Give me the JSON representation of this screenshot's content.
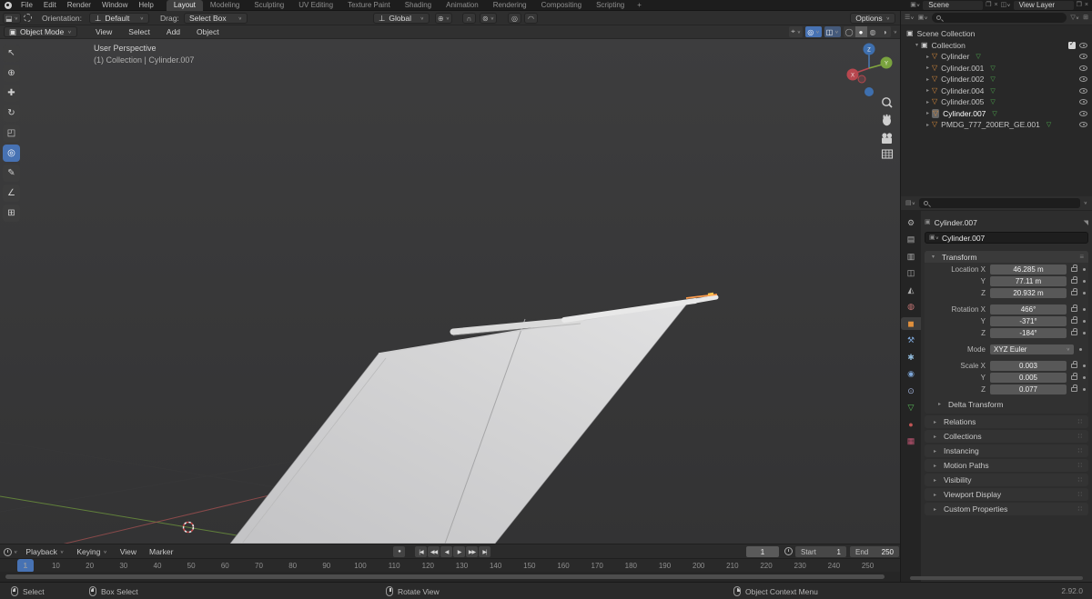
{
  "accent": "#4772b3",
  "topbar": {
    "menus": [
      "File",
      "Edit",
      "Render",
      "Window",
      "Help"
    ],
    "workspaces": [
      {
        "label": "Layout",
        "active": true
      },
      {
        "label": "Modeling"
      },
      {
        "label": "Sculpting"
      },
      {
        "label": "UV Editing"
      },
      {
        "label": "Texture Paint"
      },
      {
        "label": "Shading"
      },
      {
        "label": "Animation"
      },
      {
        "label": "Rendering"
      },
      {
        "label": "Compositing"
      },
      {
        "label": "Scripting"
      }
    ],
    "new_workspace_label": "+",
    "scene": {
      "label": "Scene"
    },
    "view_layer": {
      "label": "View Layer"
    }
  },
  "tool_settings": {
    "orientation_label": "Orientation:",
    "orientation_value": "Default",
    "drag_label": "Drag:",
    "drag_value": "Select Box",
    "transform_orientation": "Global",
    "options_label": "Options"
  },
  "viewport_header": {
    "mode": "Object Mode",
    "menus": [
      "View",
      "Select",
      "Add",
      "Object"
    ]
  },
  "viewport": {
    "overlay_title": "User Perspective",
    "overlay_breadcrumb": "(1) Collection | Cylinder.007",
    "tools": [
      {
        "name": "select-box",
        "glyph": "↖"
      },
      {
        "name": "cursor",
        "glyph": "⊕"
      },
      {
        "name": "move",
        "glyph": "✚"
      },
      {
        "name": "rotate",
        "glyph": "↻"
      },
      {
        "name": "scale",
        "glyph": "◰"
      },
      {
        "name": "transform",
        "glyph": "◎",
        "active": true
      },
      {
        "name": "annotate",
        "glyph": "✎"
      },
      {
        "name": "measure",
        "glyph": "∠"
      },
      {
        "name": "add-cube",
        "glyph": "⊞"
      }
    ]
  },
  "outliner": {
    "scene_collection": "Scene Collection",
    "collection": "Collection",
    "items": [
      {
        "name": "Cylinder"
      },
      {
        "name": "Cylinder.001"
      },
      {
        "name": "Cylinder.002"
      },
      {
        "name": "Cylinder.004"
      },
      {
        "name": "Cylinder.005"
      },
      {
        "name": "Cylinder.007",
        "selected": true
      },
      {
        "name": "PMDG_777_200ER_GE.001"
      }
    ]
  },
  "properties": {
    "tabs": [
      {
        "name": "tool",
        "glyph": "⚙",
        "color": "#b0b0b0"
      },
      {
        "name": "render",
        "glyph": "▤",
        "color": "#b0b0b0"
      },
      {
        "name": "output",
        "glyph": "▥",
        "color": "#b0b0b0"
      },
      {
        "name": "view-layer",
        "glyph": "◫",
        "color": "#b0b0b0"
      },
      {
        "name": "scene",
        "glyph": "◭",
        "color": "#b0b0b0"
      },
      {
        "name": "world",
        "glyph": "◍",
        "color": "#c97777"
      },
      {
        "name": "object",
        "glyph": "◼",
        "color": "#e0903c",
        "active": true
      },
      {
        "name": "modifiers",
        "glyph": "⚒",
        "color": "#7da6d8"
      },
      {
        "name": "particles",
        "glyph": "✱",
        "color": "#8fb8d8"
      },
      {
        "name": "physics",
        "glyph": "◉",
        "color": "#7da6d8"
      },
      {
        "name": "constraints",
        "glyph": "⊙",
        "color": "#9fb0d8"
      },
      {
        "name": "object-data",
        "glyph": "▽",
        "color": "#58b858"
      },
      {
        "name": "material",
        "glyph": "●",
        "color": "#c05555"
      },
      {
        "name": "texture",
        "glyph": "▦",
        "color": "#c05573"
      }
    ],
    "breadcrumb": "Cylinder.007",
    "name_field": "Cylinder.007",
    "transform": {
      "title": "Transform",
      "rows": [
        {
          "label": "Location X",
          "value": "46.285 m"
        },
        {
          "label": "Y",
          "value": "77.11 m"
        },
        {
          "label": "Z",
          "value": "20.932 m"
        },
        {
          "label": "Rotation X",
          "value": "466°",
          "gap": true
        },
        {
          "label": "Y",
          "value": "-371°"
        },
        {
          "label": "Z",
          "value": "-184°"
        },
        {
          "label": "Mode",
          "value": "XYZ Euler",
          "type": "mode",
          "gap": true
        },
        {
          "label": "Scale X",
          "value": "0.003",
          "gap": true
        },
        {
          "label": "Y",
          "value": "0.005"
        },
        {
          "label": "Z",
          "value": "0.077"
        }
      ],
      "delta_label": "Delta Transform"
    },
    "panels": [
      "Relations",
      "Collections",
      "Instancing",
      "Motion Paths",
      "Visibility",
      "Viewport Display",
      "Custom Properties"
    ]
  },
  "timeline": {
    "menus": [
      {
        "label": "Playback",
        "dropdown": true
      },
      {
        "label": "Keying",
        "dropdown": true
      },
      {
        "label": "View"
      },
      {
        "label": "Marker"
      }
    ],
    "playback_icons": [
      "|◀",
      "◀◀",
      "◀",
      "▶",
      "▶▶",
      "▶|"
    ],
    "current_frame": "1",
    "start_label": "Start",
    "start_value": "1",
    "end_label": "End",
    "end_value": "250",
    "frames": [
      1,
      10,
      20,
      30,
      40,
      50,
      60,
      70,
      80,
      90,
      100,
      110,
      120,
      130,
      140,
      150,
      160,
      170,
      180,
      190,
      200,
      210,
      220,
      230,
      240,
      250
    ]
  },
  "statusbar": {
    "hints": [
      {
        "icon": "mouse-left",
        "label": "Select"
      },
      {
        "icon": "mouse-drag",
        "label": "Box Select"
      },
      {
        "icon": "mouse-middle",
        "label": "Rotate View"
      },
      {
        "icon": "mouse-right",
        "label": "Object Context Menu"
      }
    ],
    "version": "2.92.0"
  }
}
